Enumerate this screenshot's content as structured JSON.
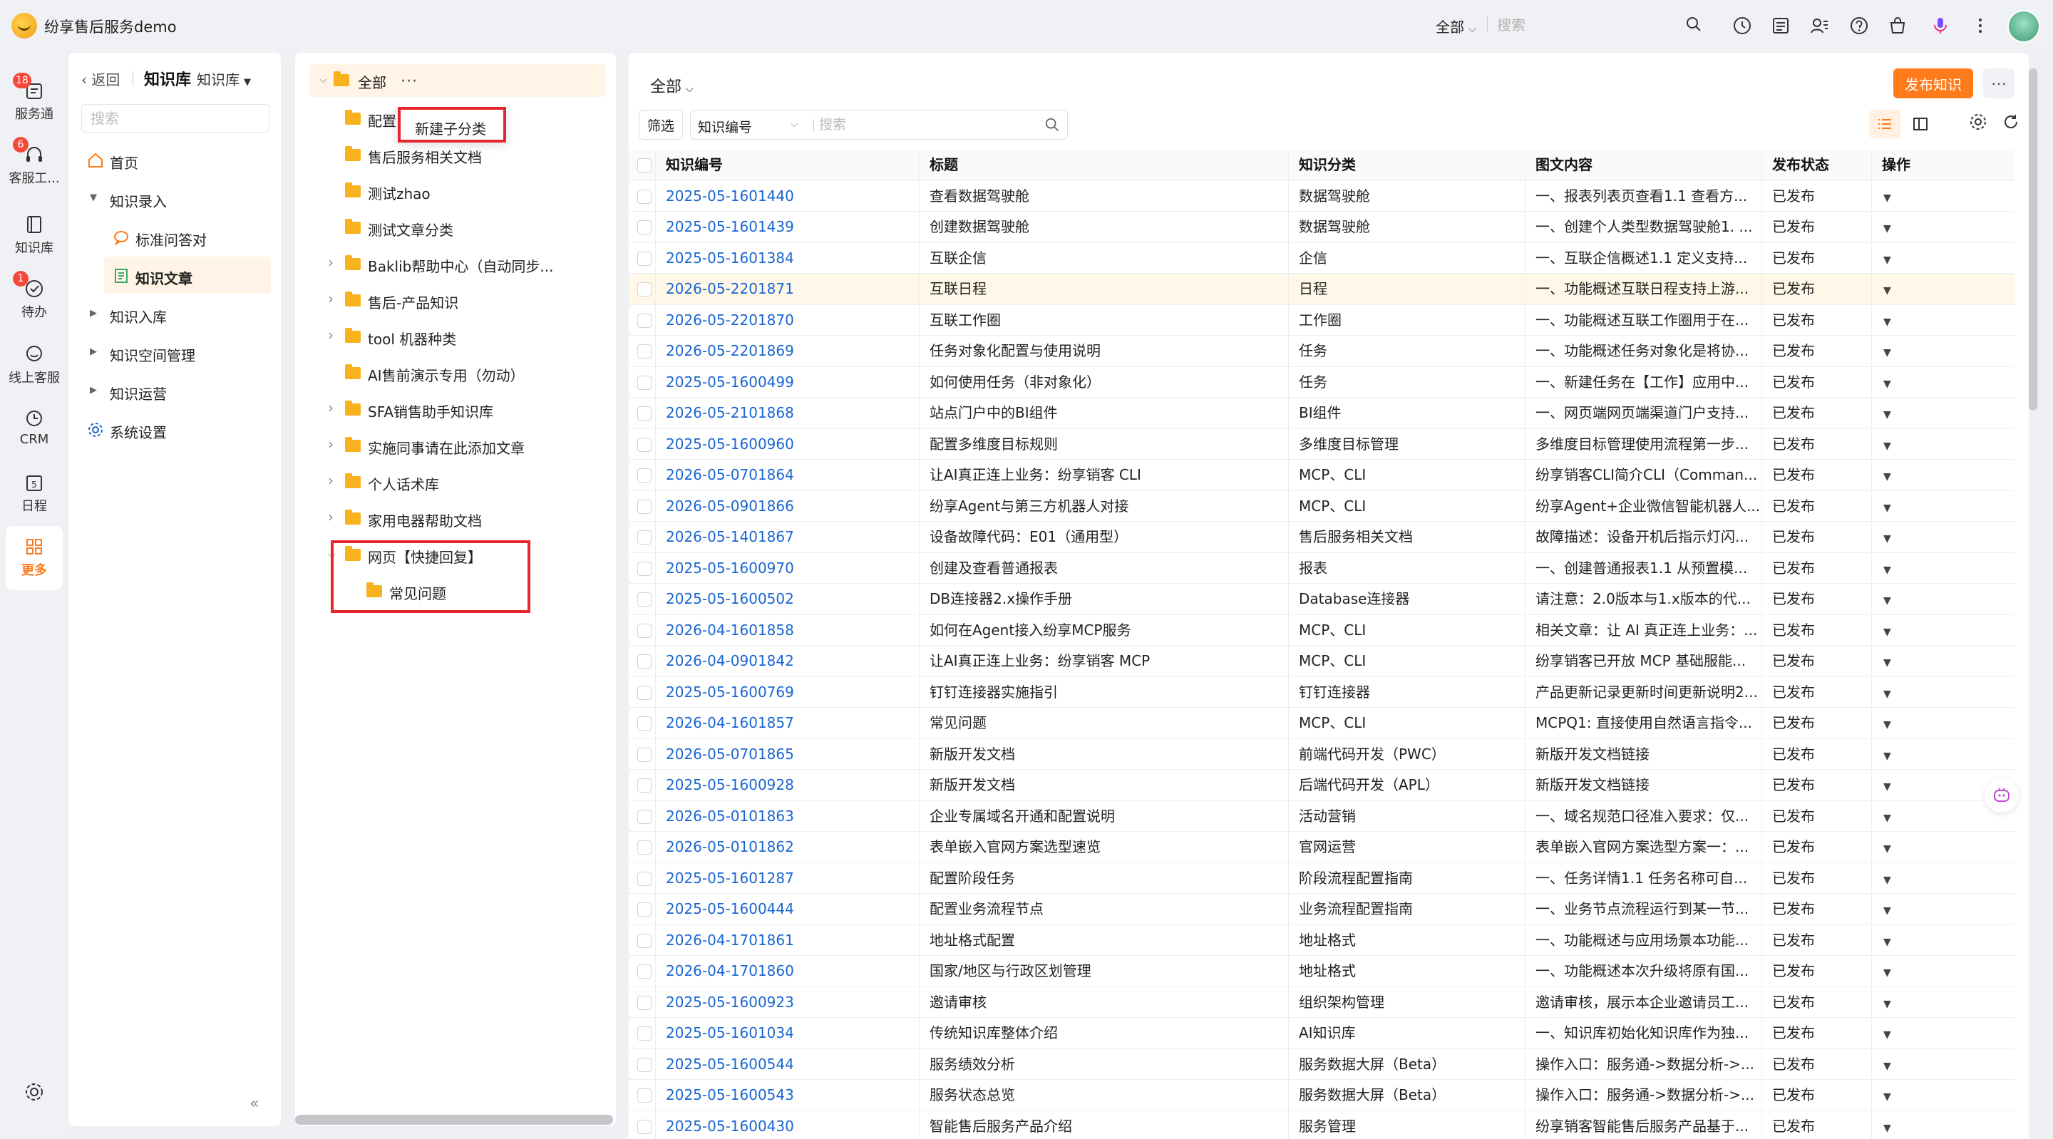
{
  "topbar": {
    "app_title": "纷享售后服务demo",
    "scope": "全部",
    "search_placeholder": "搜索",
    "icons": [
      "clock-icon",
      "message-icon",
      "contacts-icon",
      "help-icon",
      "bag-icon",
      "mic-icon",
      "more-vertical-icon"
    ]
  },
  "rail": {
    "items": [
      {
        "label": "服务通",
        "icon": "service-icon",
        "badge": "18"
      },
      {
        "label": "客服工...",
        "icon": "headset-icon",
        "badge": "6"
      },
      {
        "label": "知识库",
        "icon": "book-icon",
        "badge": ""
      },
      {
        "label": "待办",
        "icon": "todo-icon",
        "badge": "1"
      },
      {
        "label": "线上客服",
        "icon": "chat-icon",
        "badge": ""
      },
      {
        "label": "CRM",
        "icon": "crm-icon",
        "badge": ""
      },
      {
        "label": "日程",
        "icon": "calendar-icon",
        "badge": ""
      },
      {
        "label": "更多",
        "icon": "grid-icon",
        "badge": ""
      }
    ]
  },
  "nav": {
    "back_label": "返回",
    "title": "知识库",
    "subtitle": "知识库",
    "search_placeholder": "搜索",
    "items": [
      {
        "label": "首页"
      },
      {
        "label": "知识录入"
      },
      {
        "label": "标准问答对"
      },
      {
        "label": "知识文章"
      },
      {
        "label": "知识入库"
      },
      {
        "label": "知识空间管理"
      },
      {
        "label": "知识运营"
      },
      {
        "label": "系统设置"
      }
    ]
  },
  "tree": {
    "root": "全部",
    "context_menu_item": "新建子分类",
    "nodes": [
      {
        "label": "配置"
      },
      {
        "label": "售后服务相关文档"
      },
      {
        "label": "测试zhao"
      },
      {
        "label": "测试文章分类"
      },
      {
        "label": "Baklib帮助中心（自动同步..."
      },
      {
        "label": "售后-产品知识"
      },
      {
        "label": "tool 机器种类"
      },
      {
        "label": "AI售前演示专用（勿动）"
      },
      {
        "label": "SFA销售助手知识库"
      },
      {
        "label": "实施同事请在此添加文章"
      },
      {
        "label": "个人话术库"
      },
      {
        "label": "家用电器帮助文档"
      },
      {
        "label": "网页【快捷回复】"
      },
      {
        "label": "常见问题"
      }
    ]
  },
  "main": {
    "title": "全部",
    "publish_label": "发布知识",
    "more_label": "···",
    "filter_label": "筛选",
    "field_select": "知识编号",
    "search_placeholder": "搜索",
    "columns": [
      "知识编号",
      "标题",
      "知识分类",
      "图文内容",
      "发布状态",
      "操作"
    ],
    "rows": [
      [
        "2025-05-1601440",
        "查看数据驾驶舱",
        "数据驾驶舱",
        "一、报表列表页查看1.1 查看方...",
        "已发布"
      ],
      [
        "2025-05-1601439",
        "创建数据驾驶舱",
        "数据驾驶舱",
        "一、创建个人类型数据驾驶舱1. ...",
        "已发布"
      ],
      [
        "2025-05-1601384",
        "互联企信",
        "企信",
        "一、互联企信概述1.1 定义支持...",
        "已发布"
      ],
      [
        "2026-05-2201871",
        "互联日程",
        "日程",
        "一、功能概述互联日程支持上游...",
        "已发布"
      ],
      [
        "2026-05-2201870",
        "互联工作圈",
        "工作圈",
        "一、功能概述互联工作圈用于在...",
        "已发布"
      ],
      [
        "2026-05-2201869",
        "任务对象化配置与使用说明",
        "任务",
        "一、功能概述任务对象化是将协...",
        "已发布"
      ],
      [
        "2025-05-1600499",
        "如何使用任务（非对象化）",
        "任务",
        "一、新建任务在【工作】应用中...",
        "已发布"
      ],
      [
        "2026-05-2101868",
        "站点门户中的BI组件",
        "BI组件",
        "一、网页端网页端渠道门户支持...",
        "已发布"
      ],
      [
        "2025-05-1600960",
        "配置多维度目标规则",
        "多维度目标管理",
        "多维度目标管理使用流程第一步...",
        "已发布"
      ],
      [
        "2026-05-0701864",
        "让AI真正连上业务：纷享销客 CLI",
        "MCP、CLI",
        "纷享销客CLI简介CLI（Comman...",
        "已发布"
      ],
      [
        "2026-05-0901866",
        "纷享Agent与第三方机器人对接",
        "MCP、CLI",
        "纷享Agent+企业微信智能机器人...",
        "已发布"
      ],
      [
        "2026-05-1401867",
        "设备故障代码：E01（通用型）",
        "售后服务相关文档",
        "故障描述：设备开机后指示灯闪...",
        "已发布"
      ],
      [
        "2025-05-1600970",
        "创建及查看普通报表",
        "报表",
        "一、创建普通报表1.1 从预置模...",
        "已发布"
      ],
      [
        "2025-05-1600502",
        "DB连接器2.x操作手册",
        "Database连接器",
        "请注意：2.0版本与1.x版本的代...",
        "已发布"
      ],
      [
        "2026-04-1601858",
        "如何在Agent接入纷享MCP服务",
        "MCP、CLI",
        "相关文章：让 AI 真正连上业务：...",
        "已发布"
      ],
      [
        "2026-04-0901842",
        "让AI真正连上业务：纷享销客 MCP",
        "MCP、CLI",
        "纷享销客已开放 MCP 基础服能...",
        "已发布"
      ],
      [
        "2025-05-1600769",
        "钉钉连接器实施指引",
        "钉钉连接器",
        "产品更新记录更新时间更新说明2...",
        "已发布"
      ],
      [
        "2026-04-1601857",
        "常见问题",
        "MCP、CLI",
        "MCPQ1: 直接使用自然语言指令...",
        "已发布"
      ],
      [
        "2026-05-0701865",
        "新版开发文档",
        "前端代码开发（PWC）",
        "新版开发文档链接",
        "已发布"
      ],
      [
        "2025-05-1600928",
        "新版开发文档",
        "后端代码开发（APL）",
        "新版开发文档链接",
        "已发布"
      ],
      [
        "2026-05-0101863",
        "企业专属域名开通和配置说明",
        "活动营销",
        "一、域名规范口径准入要求：仅...",
        "已发布"
      ],
      [
        "2026-05-0101862",
        "表单嵌入官网方案选型速览",
        "官网运营",
        "表单嵌入官网方案选型方案一：...",
        "已发布"
      ],
      [
        "2025-05-1601287",
        "配置阶段任务",
        "阶段流程配置指南",
        "一、任务详情1.1 任务名称可自...",
        "已发布"
      ],
      [
        "2025-05-1600444",
        "配置业务流程节点",
        "业务流程配置指南",
        "一、业务节点流程运行到某一节...",
        "已发布"
      ],
      [
        "2026-04-1701861",
        "地址格式配置",
        "地址格式",
        "一、功能概述与应用场景本功能...",
        "已发布"
      ],
      [
        "2026-04-1701860",
        "国家/地区与行政区划管理",
        "地址格式",
        "一、功能概述本次升级将原有国...",
        "已发布"
      ],
      [
        "2025-05-1600923",
        "邀请审核",
        "组织架构管理",
        "邀请审核，展示本企业邀请员工...",
        "已发布"
      ],
      [
        "2025-05-1601034",
        "传统知识库整体介绍",
        "AI知识库",
        "一、知识库初始化知识库作为独...",
        "已发布"
      ],
      [
        "2025-05-1600544",
        "服务绩效分析",
        "服务数据大屏（Beta）",
        "操作入口：服务通->数据分析->...",
        "已发布"
      ],
      [
        "2025-05-1600543",
        "服务状态总览",
        "服务数据大屏（Beta）",
        "操作入口：服务通->数据分析->...",
        "已发布"
      ],
      [
        "2025-05-1600430",
        "智能售后服务产品介绍",
        "服务管理",
        "纷享销客智能售后服务产品基于...",
        "已发布"
      ]
    ]
  },
  "colors": {
    "accent": "#ff7a1a",
    "link": "#1a66d1",
    "badge": "#f5483b",
    "folder": "#f7b21e",
    "highlight_border": "#e6262e"
  }
}
